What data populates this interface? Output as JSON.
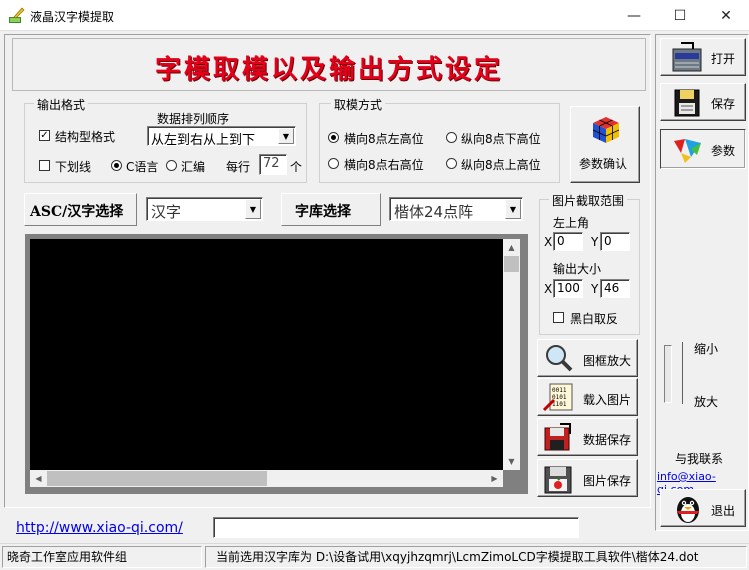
{
  "window": {
    "title": "液晶汉字模提取",
    "minimize": "—",
    "maximize": "☐",
    "close": "✕"
  },
  "banner": {
    "text": "字模取模以及输出方式设定"
  },
  "output_format": {
    "label": "输出格式",
    "structured_label": "结构型格式",
    "structured_checked": true,
    "underline_label": "下划线",
    "underline_checked": false,
    "order_label": "数据排列顺序",
    "order_value": "从左到右从上到下",
    "c_label": "C语言",
    "asm_label": "汇编",
    "selected_lang": "C语言",
    "per_row_label": "每行",
    "per_row_value": "72",
    "per_row_unit": "个"
  },
  "scan_mode": {
    "label": "取模方式",
    "options": [
      "横向8点左高位",
      "纵向8点下高位",
      "横向8点右高位",
      "纵向8点上高位"
    ],
    "selected": "横向8点左高位"
  },
  "confirm_button": {
    "label": "参数确认"
  },
  "char_select": {
    "label": "ASC/汉字选择",
    "value": "汉字"
  },
  "font_select": {
    "label": "字库选择",
    "value": "楷体24点阵"
  },
  "crop": {
    "label": "图片截取范围",
    "top_left_label": "左上角",
    "x_label": "X",
    "x_value": "0",
    "y_label": "Y",
    "y_value": "0",
    "size_label": "输出大小",
    "w_label": "X",
    "w_value": "100",
    "h_label": "Y",
    "h_value": "46",
    "invert_label": "黑白取反",
    "invert_checked": false
  },
  "action_buttons": [
    {
      "label": "图框放大"
    },
    {
      "label": "载入图片"
    },
    {
      "label": "数据保存"
    },
    {
      "label": "图片保存"
    }
  ],
  "right_buttons": [
    {
      "label": "打开"
    },
    {
      "label": "保存"
    },
    {
      "label": "参数"
    }
  ],
  "zoom": {
    "shrink_label": "缩小",
    "enlarge_label": "放大"
  },
  "contact": {
    "label": "与我联系",
    "email": "info@xiao-qi.com"
  },
  "exit_button": {
    "label": "退出"
  },
  "footer": {
    "url": "http://www.xiao-qi.com/",
    "input_value": ""
  },
  "status": {
    "left": "晓奇工作室应用软件组",
    "right": "当前选用汉字库为 D:\\设备试用\\xqyjhzqmrj\\LcmZimoLCD字模提取工具软件\\楷体24.dot"
  },
  "colors": {
    "banner_text": "#e2001a",
    "preview_bg": "#000000",
    "link": "#0000ee"
  }
}
